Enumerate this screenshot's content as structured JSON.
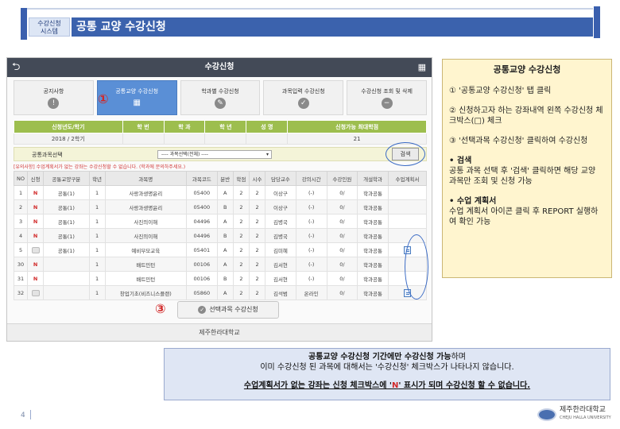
{
  "header": {
    "system_badge_line1": "수강신청",
    "system_badge_line2": "시스템",
    "title": "공통 교양 수강신청"
  },
  "app": {
    "title": "수강신청",
    "tabs": [
      "공지사항",
      "공통교양 수강신청",
      "학과별 수강신청",
      "과목입력 수강신청",
      "수강신청 조회 및 삭제"
    ],
    "info_headers": [
      "신청년도/학기",
      "학 번",
      "학 과",
      "학 년",
      "성 명",
      "신청가능 최대학점"
    ],
    "info_values": [
      "2018 / 2학기",
      "",
      "",
      "",
      "",
      "21"
    ],
    "filter_label": "공통과목선택",
    "filter_select": "---- 과목선택(전체) ----",
    "search_button": "검색",
    "notice": "[유의사항] 수업계획서가 없는 강좌는 수강신청할 수 없습니다. (학과에 문의하주세요.)",
    "course_headers": [
      "NO",
      "신청",
      "공통교양구분",
      "학년",
      "과목명",
      "과목코드",
      "분반",
      "학점",
      "시수",
      "담당교수",
      "강의시간",
      "수강인원",
      "개설학과",
      "수업계획서"
    ],
    "courses": [
      {
        "no": "1",
        "apply": "N",
        "cat": "공통(1)",
        "year": "1",
        "name": "사랑과생명윤리",
        "code": "05400",
        "sec": "A",
        "credit": "2",
        "hours": "2",
        "prof": "이상구",
        "time": "(-)",
        "enroll": "0/",
        "dept": "학과공통",
        "plan": false
      },
      {
        "no": "2",
        "apply": "N",
        "cat": "공통(1)",
        "year": "1",
        "name": "사랑과생명윤리",
        "code": "05400",
        "sec": "B",
        "credit": "2",
        "hours": "2",
        "prof": "이상구",
        "time": "(-)",
        "enroll": "0/",
        "dept": "학과공통",
        "plan": false
      },
      {
        "no": "3",
        "apply": "N",
        "cat": "공통(1)",
        "year": "1",
        "name": "사진의이해",
        "code": "04496",
        "sec": "A",
        "credit": "2",
        "hours": "2",
        "prof": "김병국",
        "time": "(-)",
        "enroll": "0/",
        "dept": "학과공통",
        "plan": false
      },
      {
        "no": "4",
        "apply": "N",
        "cat": "공통(1)",
        "year": "1",
        "name": "사진의이해",
        "code": "04496",
        "sec": "B",
        "credit": "2",
        "hours": "2",
        "prof": "김병국",
        "time": "(-)",
        "enroll": "0/",
        "dept": "학과공통",
        "plan": false
      },
      {
        "no": "5",
        "apply": "checkbox",
        "cat": "공통(1)",
        "year": "1",
        "name": "예비부모교육",
        "code": "05401",
        "sec": "A",
        "credit": "2",
        "hours": "2",
        "prof": "김미혜",
        "time": "(-)",
        "enroll": "0/",
        "dept": "학과공통",
        "plan": true
      },
      {
        "no": "30",
        "apply": "N",
        "cat": "",
        "year": "1",
        "name": "배트민턴",
        "code": "00106",
        "sec": "A",
        "credit": "2",
        "hours": "2",
        "prof": "김서현",
        "time": "(-)",
        "enroll": "0/",
        "dept": "학과공통",
        "plan": false
      },
      {
        "no": "31",
        "apply": "N",
        "cat": "",
        "year": "1",
        "name": "배트민턴",
        "code": "00106",
        "sec": "B",
        "credit": "2",
        "hours": "2",
        "prof": "김서현",
        "time": "(-)",
        "enroll": "0/",
        "dept": "학과공통",
        "plan": false
      },
      {
        "no": "32",
        "apply": "checkbox",
        "cat": "",
        "year": "1",
        "name": "창업기초(비즈니스플랜)",
        "code": "05860",
        "sec": "A",
        "credit": "2",
        "hours": "2",
        "prof": "김석범",
        "time": "온라인",
        "enroll": "0/",
        "dept": "학과공통",
        "plan": true
      }
    ],
    "apply_button": "선택과목 수강신청",
    "footer": "제주한라대학교"
  },
  "steps": {
    "one": "①",
    "three": "③"
  },
  "right_panel": {
    "title": "공통교양 수강신청",
    "step1": "① '공통교양 수강신청' 탭 클릭",
    "step2": "② 신청하고자 하는 강좌내역 왼쪽 수강신청 체크박스(□) 체크",
    "step3": "③ '선택과목 수강신청' 클릭하여 수강신청",
    "search_title": "•  검색",
    "search_desc": "공통 과목 선택 후 '검색' 클릭하면 해당 교양 과목만 조회 및 신청 가능",
    "plan_title": "•  수업 계획서",
    "plan_desc": "수업 계획서 아이콘 클릭 후 REPORT 실행하여 확인 가능"
  },
  "bottom_panel": {
    "line1_bold": "공통교양 수강신청 기간에만 수강신청 가능",
    "line1_rest": "하며",
    "line2": "이미 수강신청 된 과목에 대해서는 '수강신청' 체크박스가 나타나지 않습니다.",
    "line3_pre": "수업계획서가 없는 강좌는 신청 체크박스에 '",
    "line3_n": "N",
    "line3_post": "' 표시가 되며 수강신청 할 수 없습니다."
  },
  "page_number": "4",
  "logo": {
    "name": "제주한라대학교",
    "sub": "CHEJU HALLA UNIVERSITY"
  },
  "colors": {
    "header_blue": "#3b62ad",
    "table_green": "#9dbe4e",
    "mark_red": "#d12828",
    "right_panel_bg": "#fff5cf",
    "bottom_panel_bg": "#dfe6f4"
  }
}
